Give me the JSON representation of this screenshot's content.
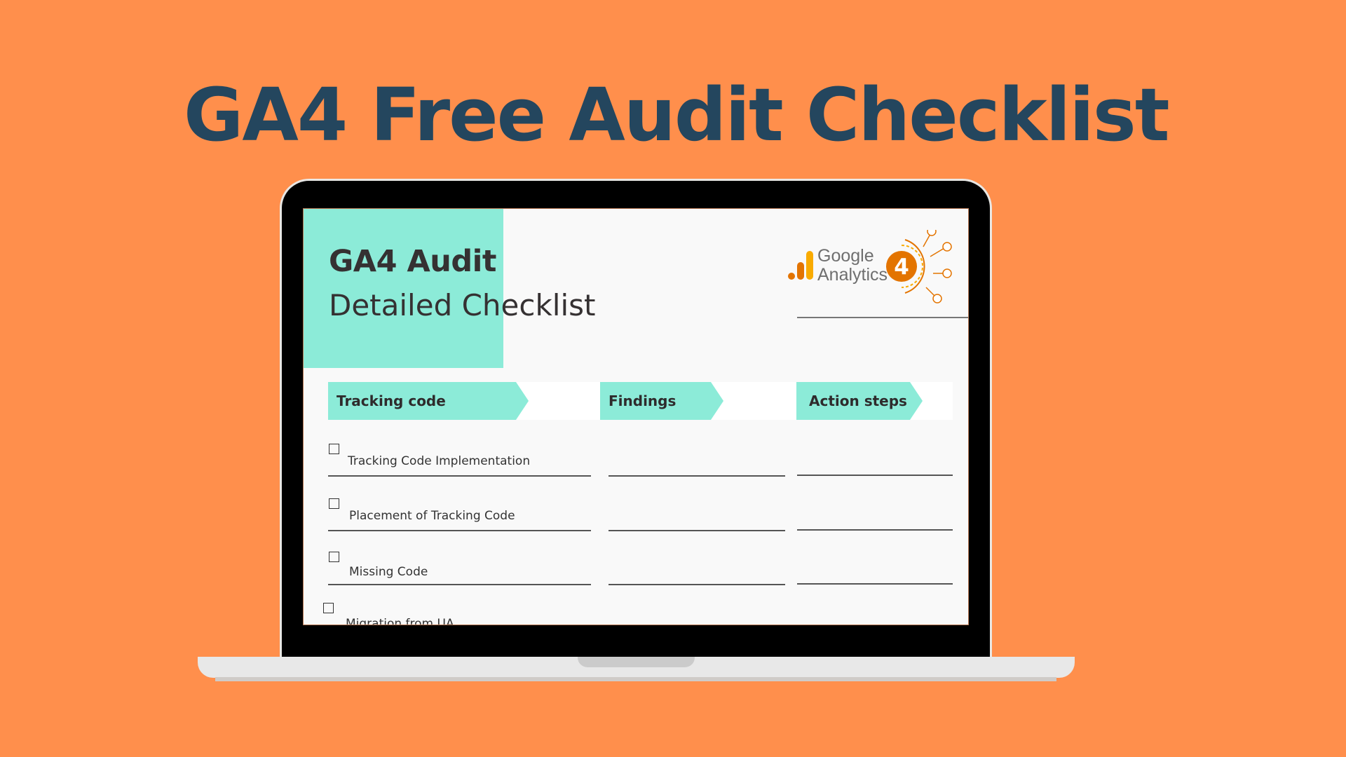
{
  "page": {
    "title": "GA4 Free Audit Checklist",
    "background_color": "#ff8f4c",
    "title_color": "#24465e"
  },
  "document": {
    "title": "GA4 Audit",
    "subtitle": "Detailed Checklist",
    "accent_color": "#8cebd8",
    "logo": {
      "line1": "Google",
      "line2": "Analytics",
      "badge": "4",
      "icon": "google-analytics-4-logo"
    },
    "columns": [
      {
        "label": "Tracking code"
      },
      {
        "label": "Findings"
      },
      {
        "label": "Action steps"
      }
    ],
    "items": [
      {
        "label": "Tracking Code Implementation",
        "checked": false
      },
      {
        "label": "Placement of Tracking Code",
        "checked": false
      },
      {
        "label": "Missing Code",
        "checked": false
      },
      {
        "label": "Migration from UA",
        "checked": false
      }
    ]
  }
}
